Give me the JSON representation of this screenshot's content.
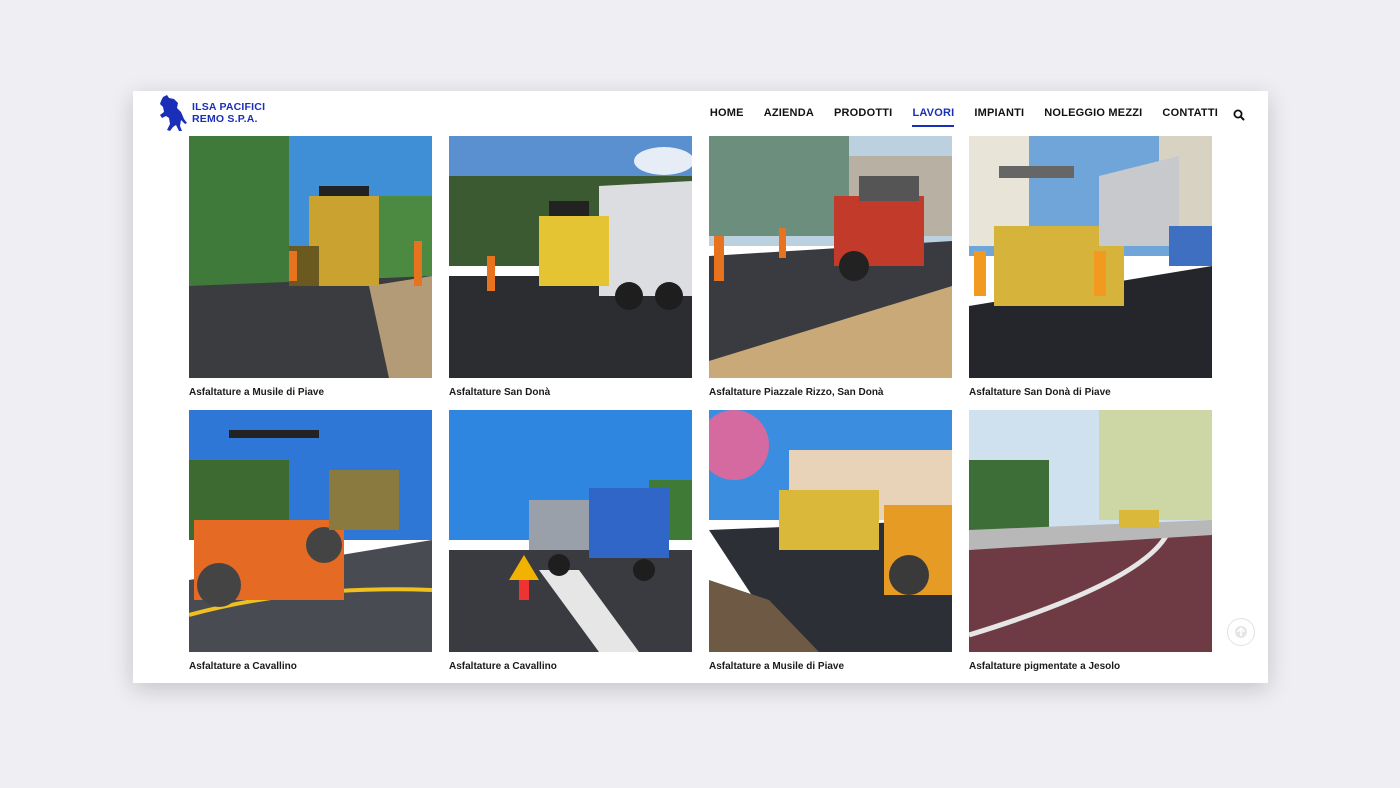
{
  "brand": {
    "line1": "ILSA PACIFICI",
    "line2": "REMO S.P.A.",
    "logo_icon": "rearing-horse-icon",
    "color": "#1a2fb8"
  },
  "nav": {
    "items": [
      {
        "label": "HOME",
        "active": false
      },
      {
        "label": "AZIENDA",
        "active": false
      },
      {
        "label": "PRODOTTI",
        "active": false
      },
      {
        "label": "LAVORI",
        "active": true
      },
      {
        "label": "IMPIANTI",
        "active": false
      },
      {
        "label": "NOLEGGIO MEZZI",
        "active": false
      },
      {
        "label": "CONTATTI",
        "active": false
      }
    ],
    "search_icon": "search-icon"
  },
  "projects": [
    {
      "caption": "Asfaltature a Musile di Piave"
    },
    {
      "caption": "Asfaltature San Donà"
    },
    {
      "caption": "Asfaltature Piazzale Rizzo, San Donà"
    },
    {
      "caption": "Asfaltature San Donà di Piave"
    },
    {
      "caption": "Asfaltature a Cavallino"
    },
    {
      "caption": "Asfaltature a Cavallino"
    },
    {
      "caption": "Asfaltature a Musile di Piave"
    },
    {
      "caption": "Asfaltature pigmentate a Jesolo"
    }
  ],
  "scroll_top_icon": "arrow-up-icon"
}
